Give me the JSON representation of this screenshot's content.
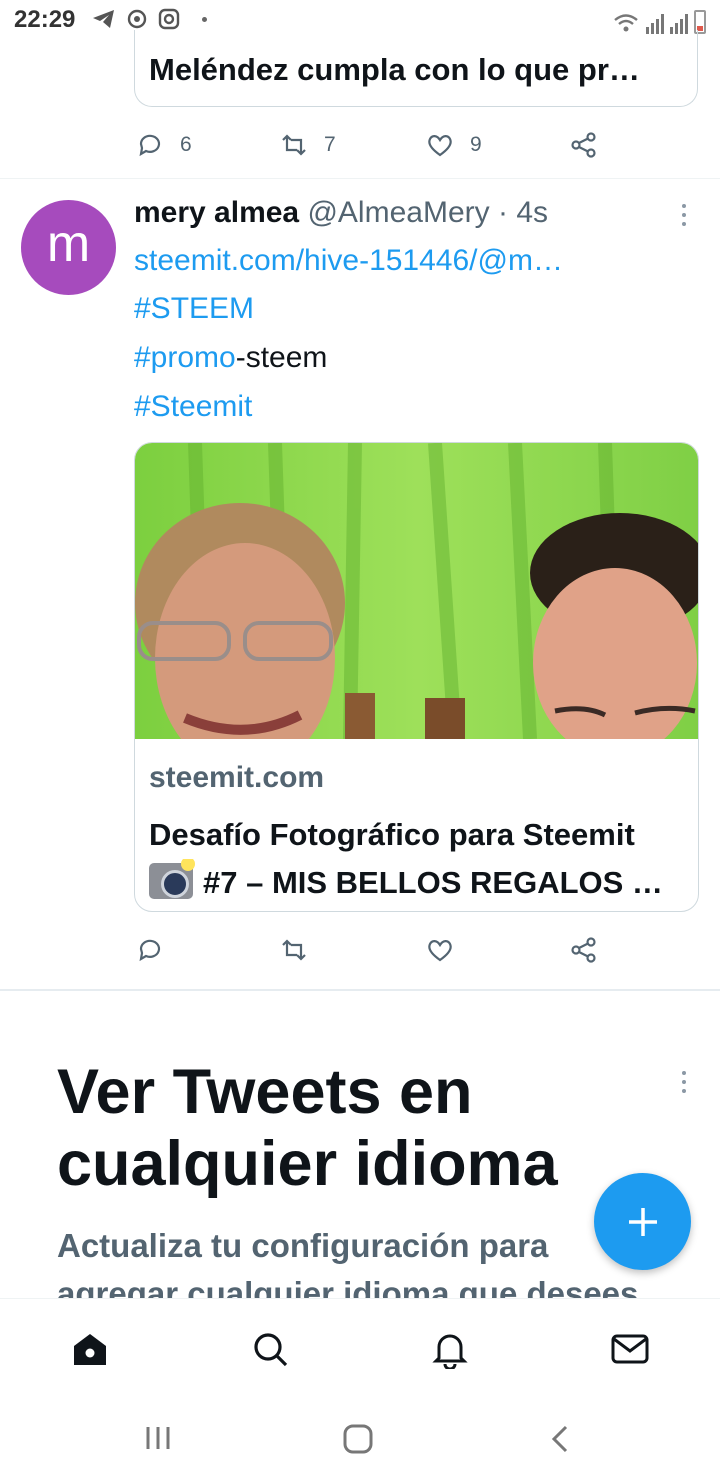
{
  "status_bar": {
    "time": "22:29",
    "left_icons": [
      "telegram-icon",
      "signal-app-icon",
      "instagram-icon",
      "dot-icon"
    ],
    "right_icons": [
      "wifi-icon",
      "signal-bars-icon",
      "signal-bars-icon",
      "battery-low-icon"
    ]
  },
  "previous_tweet": {
    "card_title": "Meléndez cumpla con lo que pr…",
    "replies": "6",
    "retweets": "7",
    "likes": "9"
  },
  "tweet": {
    "avatar_letter": "m",
    "avatar_color": "#a64bbd",
    "name": "mery almea",
    "handle": "@AlmeaMery",
    "separator": "·",
    "time": "4s",
    "link_text": "steemit.com/hive-151446/@m…",
    "hashtag_steem": "#STEEM",
    "hashtag_promo": "#promo",
    "promo_suffix": "-steem",
    "hashtag_steemit": "#Steemit",
    "card": {
      "domain": "steemit.com",
      "title_line1": "Desafío Fotográfico para Steemit",
      "title_line2": "#7 – MIS BELLOS REGALOS …"
    }
  },
  "promo": {
    "title": "Ver Tweets en cualquier idioma",
    "subtitle": "Actualiza tu configuración para agregar cualquier idioma que desees"
  },
  "fab_icon": "plus-icon",
  "bottom_nav": [
    "home-icon",
    "search-icon",
    "notifications-bell-icon",
    "messages-envelope-icon"
  ],
  "system_nav": [
    "recent-apps-icon",
    "home-circle-icon",
    "back-chevron-icon"
  ],
  "colors": {
    "accent": "#1d9bf0",
    "secondary_text": "#536471",
    "card_image_green": "#8cd44f"
  }
}
